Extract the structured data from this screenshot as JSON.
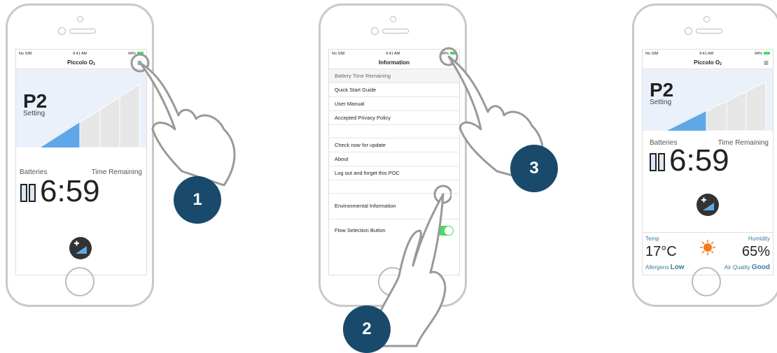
{
  "status": {
    "carrier": "No SIM",
    "time": "9:41 AM",
    "battery": "94%"
  },
  "screen1": {
    "title": "Piccolo O",
    "title_sub": "2",
    "setting_value": "P2",
    "setting_label": "Setting",
    "batteries_label": "Batteries",
    "time_remaining_label": "Time Remaining",
    "time_value": "6:59"
  },
  "screen2": {
    "title": "Information",
    "items": [
      "Battery Time Remaining",
      "Quick Start Guide",
      "User Manual",
      "Accepted Privacy Policy",
      "Check now for update",
      "About",
      "Log out and forget this POC",
      "Environmental Information",
      "Flow Selection Button"
    ]
  },
  "screen3": {
    "title": "Piccolo O",
    "title_sub": "2",
    "setting_value": "P2",
    "setting_label": "Setting",
    "batteries_label": "Batteries",
    "time_remaining_label": "Time Remaining",
    "time_value": "6:59",
    "temp_label": "Temp",
    "temp_value": "17°C",
    "humidity_label": "Humidity",
    "humidity_value": "65%",
    "allergens_label": "Allergens",
    "allergens_value": "Low",
    "air_quality_label": "Air Quality",
    "air_quality_value": "Good"
  },
  "steps": [
    "1",
    "2",
    "3"
  ],
  "colors": {
    "badge": "#1a4a6b",
    "bars_active": "#5fa8e8",
    "toggle": "#4cd964"
  }
}
